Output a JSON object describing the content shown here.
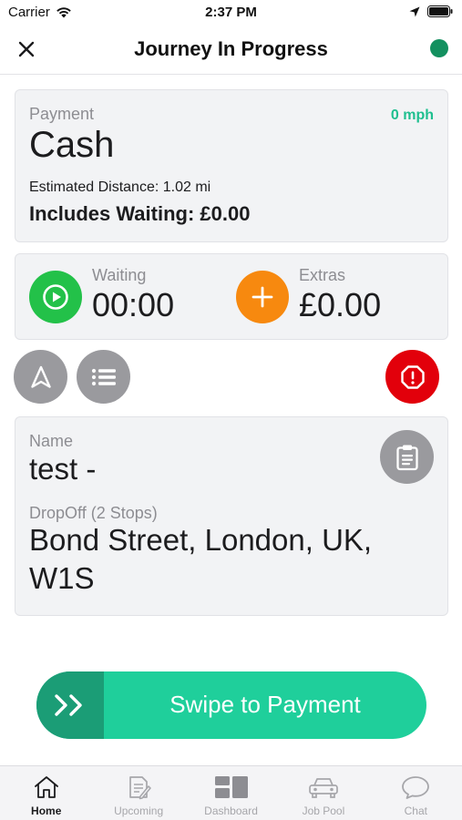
{
  "status_bar": {
    "carrier": "Carrier",
    "time": "2:37 PM"
  },
  "header": {
    "title": "Journey In Progress",
    "status_color": "#13905f"
  },
  "payment": {
    "label": "Payment",
    "method": "Cash",
    "speed": "0 mph",
    "distance": "Estimated Distance: 1.02 mi",
    "waiting_total": "Includes Waiting: £0.00"
  },
  "timer": {
    "waiting_label": "Waiting",
    "waiting_value": "00:00",
    "extras_label": "Extras",
    "extras_value": "£0.00"
  },
  "actions": {
    "icons": [
      "navigation-arrow-icon",
      "list-icon",
      "alert-icon"
    ]
  },
  "booking": {
    "name_label": "Name",
    "name_value": "test -",
    "dropoff_label": "DropOff (2 Stops)",
    "dropoff_address": "Bond Street, London, UK, W1S"
  },
  "swipe": {
    "label": "Swipe to Payment"
  },
  "tab_bar": {
    "tabs": [
      {
        "label": "Home",
        "icon": "home-icon",
        "active": true
      },
      {
        "label": "Upcoming",
        "icon": "upcoming-icon",
        "active": false
      },
      {
        "label": "Dashboard",
        "icon": "dashboard-icon",
        "active": false
      },
      {
        "label": "Job Pool",
        "icon": "car-icon",
        "active": false
      },
      {
        "label": "Chat",
        "icon": "chat-icon",
        "active": false
      }
    ]
  },
  "colors": {
    "accent_green": "#1fcf9b",
    "swipe_handle": "#1b9d76",
    "play_green": "#23c149",
    "extras_orange": "#f7890f",
    "alert_red": "#e2000b",
    "speed_text": "#1fbf8f"
  }
}
